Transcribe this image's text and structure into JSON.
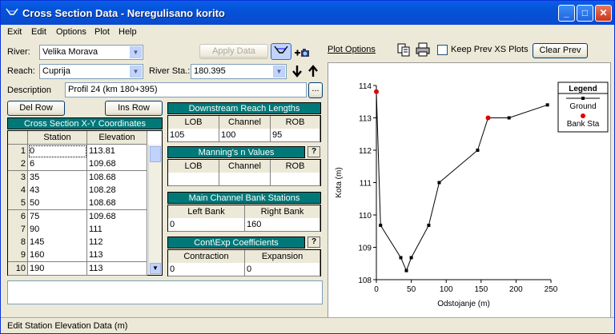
{
  "window": {
    "title": "Cross Section Data - Neregulisano korito"
  },
  "titlebar_buttons": {
    "minimize": "_",
    "maximize": "□",
    "close": "✕"
  },
  "menu": [
    "Exit",
    "Edit",
    "Options",
    "Plot",
    "Help"
  ],
  "river": {
    "label": "River:",
    "value": "Velika Morava"
  },
  "reach": {
    "label": "Reach:",
    "value": "Cuprija"
  },
  "river_sta": {
    "label": "River Sta.:",
    "value": "180.395"
  },
  "description": {
    "label": "Description",
    "value": "Profil 24 (km 180+395)",
    "button": "..."
  },
  "buttons": {
    "apply_data": "Apply Data",
    "del_row": "Del Row",
    "ins_row": "Ins Row",
    "plot_options": "Plot Options",
    "keep_prev": "Keep Prev XS Plots",
    "clear_prev": "Clear Prev"
  },
  "xs_table": {
    "title": "Cross Section X-Y Coordinates",
    "columns": [
      "Station",
      "Elevation"
    ],
    "rows": [
      {
        "n": "1",
        "station": "0",
        "elev": "113.81"
      },
      {
        "n": "2",
        "station": "6",
        "elev": "109.68"
      },
      {
        "n": "3",
        "station": "35",
        "elev": "108.68"
      },
      {
        "n": "4",
        "station": "43",
        "elev": "108.28"
      },
      {
        "n": "5",
        "station": "50",
        "elev": "108.68"
      },
      {
        "n": "6",
        "station": "75",
        "elev": "109.68"
      },
      {
        "n": "7",
        "station": "90",
        "elev": "111"
      },
      {
        "n": "8",
        "station": "145",
        "elev": "112"
      },
      {
        "n": "9",
        "station": "160",
        "elev": "113"
      },
      {
        "n": "10",
        "station": "190",
        "elev": "113"
      }
    ]
  },
  "downstream": {
    "title": "Downstream Reach Lengths",
    "columns": [
      "LOB",
      "Channel",
      "ROB"
    ],
    "values": [
      "105",
      "100",
      "95"
    ]
  },
  "mannings": {
    "title": "Manning's n Values",
    "columns": [
      "LOB",
      "Channel",
      "ROB"
    ],
    "values": [
      "",
      "",
      ""
    ]
  },
  "bank_stations": {
    "title": "Main Channel Bank Stations",
    "columns": [
      "Left Bank",
      "Right Bank"
    ],
    "values": [
      "0",
      "160"
    ]
  },
  "cont_exp": {
    "title": "Cont\\Exp  Coefficients",
    "columns": [
      "Contraction",
      "Expansion"
    ],
    "values": [
      "0",
      "0"
    ]
  },
  "status": "Edit Station Elevation Data (m)",
  "colors": {
    "teal": "#007878",
    "ground": "#000000",
    "bank_sta": "#e00000"
  },
  "chart_data": {
    "type": "line",
    "xlabel": "Odstojanje (m)",
    "ylabel": "Kota (m)",
    "xlim": [
      0,
      250
    ],
    "ylim": [
      108,
      114
    ],
    "x_ticks": [
      "0",
      "50",
      "100",
      "150",
      "200",
      "250"
    ],
    "y_ticks": [
      "108",
      "109",
      "110",
      "111",
      "112",
      "113",
      "114"
    ],
    "legend_title": "Legend",
    "legend": [
      "Ground",
      "Bank Sta"
    ],
    "series": [
      {
        "name": "Ground",
        "x": [
          0,
          6,
          35,
          43,
          50,
          75,
          90,
          145,
          160,
          190,
          245
        ],
        "y": [
          113.81,
          109.68,
          108.68,
          108.28,
          108.68,
          109.68,
          111,
          112,
          113,
          113,
          113.4
        ]
      },
      {
        "name": "Bank Sta",
        "x": [
          0,
          160
        ],
        "y": [
          113.81,
          113
        ]
      }
    ]
  }
}
